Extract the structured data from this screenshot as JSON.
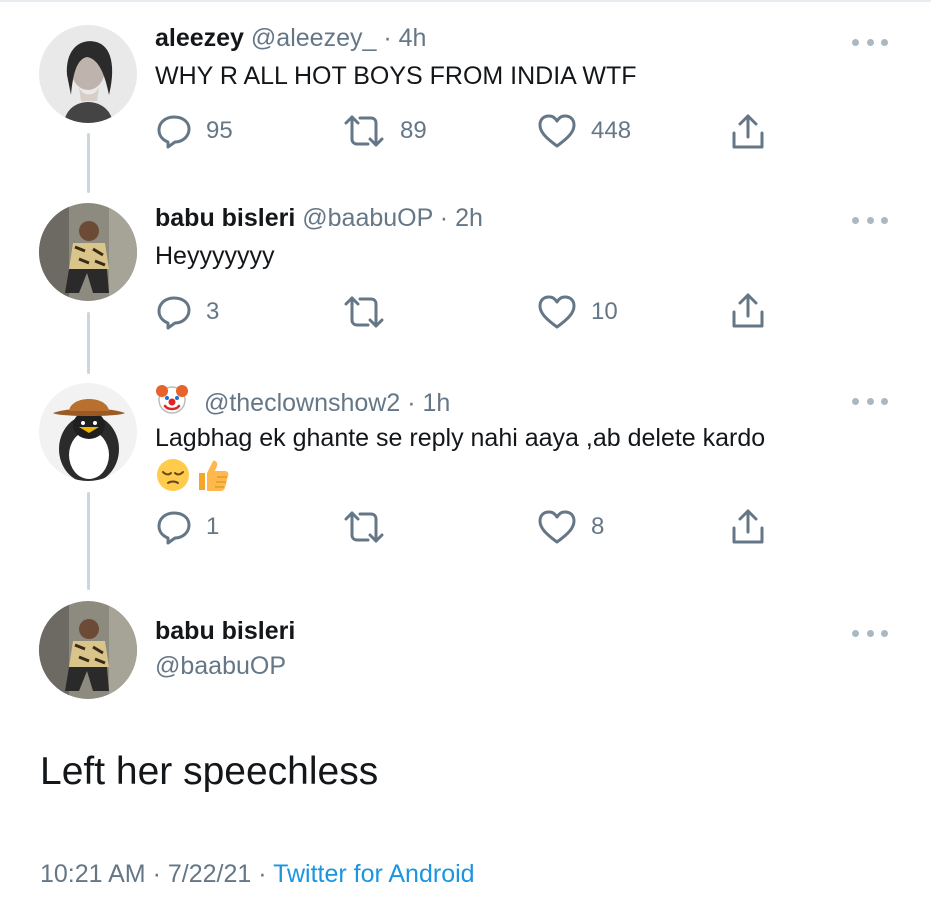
{
  "colors": {
    "text": "#14171a",
    "muted": "#657786",
    "link": "#1b95e0",
    "thread": "#ccd6dd"
  },
  "replies": [
    {
      "name": "aleezey",
      "handle": "@aleezey_",
      "separator": "·",
      "time": "4h",
      "text": "WHY R ALL HOT BOYS FROM INDIA WTF",
      "reply_count": "95",
      "retweet_count": "89",
      "like_count": "448"
    },
    {
      "name": "babu bisleri",
      "handle": "@baabuOP",
      "separator": "·",
      "time": "2h",
      "text": "Heyyyyyyy",
      "reply_count": "3",
      "retweet_count": "",
      "like_count": "10"
    },
    {
      "name": "",
      "name_emoji": "clown-face",
      "handle": "@theclownshow2",
      "separator": "·",
      "time": "1h",
      "text": "Lagbhag ek ghante se reply nahi aaya ,ab delete kardo",
      "text_emojis": [
        "pensive-face",
        "thumbs-up"
      ],
      "reply_count": "1",
      "retweet_count": "",
      "like_count": "8"
    }
  ],
  "main_tweet": {
    "name": "babu bisleri",
    "handle": "@baabuOP",
    "text": "Left her speechless",
    "time": "10:21 AM",
    "separator": "·",
    "date": "7/22/21",
    "source": "Twitter for Android"
  }
}
